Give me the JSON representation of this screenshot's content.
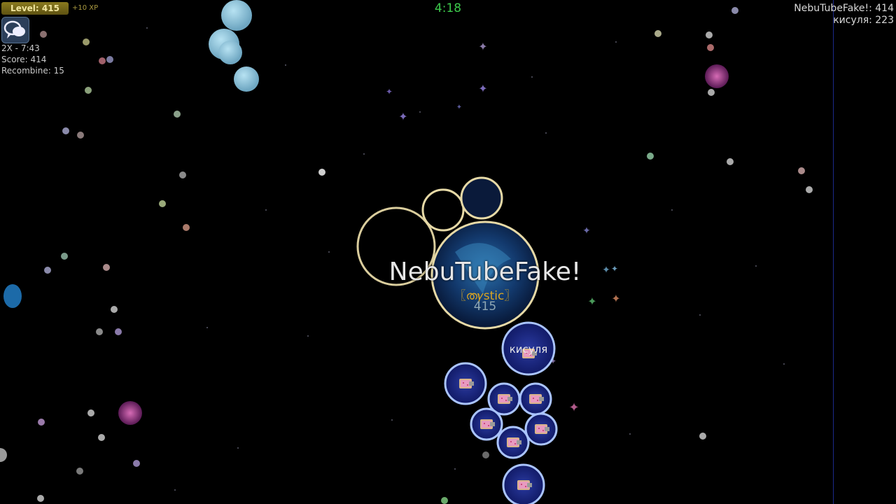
{
  "hud": {
    "level_label": "Level: 415",
    "xp_gain": "+10 XP",
    "mode_timer": "2X - 7:43",
    "score": "Score: 414",
    "recombine": "Recombine: 15",
    "match_timer": "4:18"
  },
  "leaderboard": [
    "NebuTubeFake!: 414",
    "кисуля: 223"
  ],
  "player": {
    "name": "NebuTubeFake!",
    "clan": "〖ത𝛾stic〗",
    "mass": "415"
  },
  "enemy": {
    "name": "кисуля"
  },
  "colors": {
    "background": "#000000",
    "timer": "#3cc94b",
    "clan_tag": "#d8a522",
    "level_bar": "#8a7a1e",
    "virus_blue": "#9fd0e4",
    "enemy_cell": "#1c2a8a",
    "enemy_ring": "#aac4ff",
    "player_outline": "#d9c88a"
  },
  "icons": {
    "chat": "chat-bubbles-icon",
    "enemy_skin": "nyan-cat-skin-icon",
    "player_skin": "nebula-skin-icon"
  }
}
